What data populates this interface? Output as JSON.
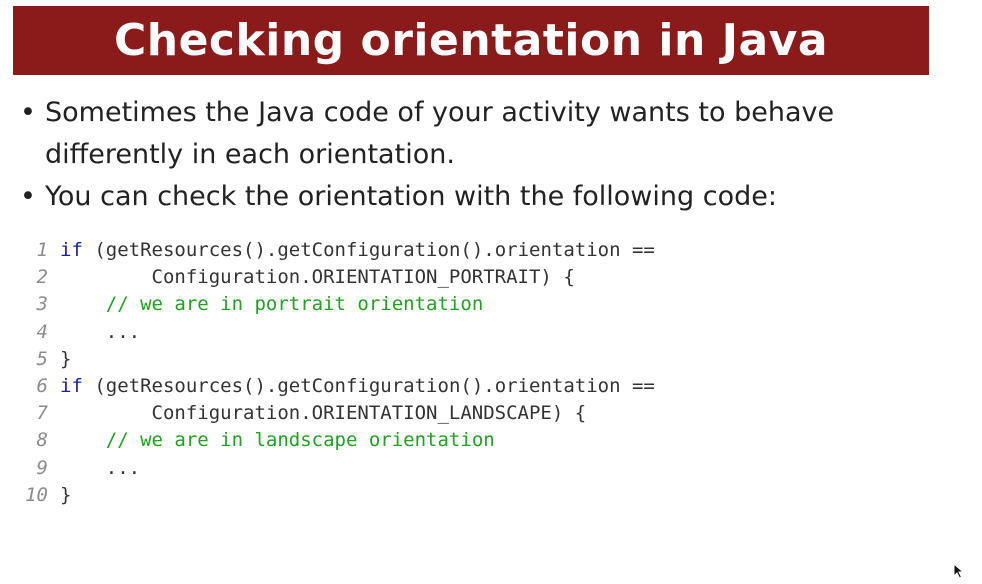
{
  "slide": {
    "title": "Checking orientation in Java",
    "bullets": [
      {
        "lines": [
          "Sometimes the Java code of your activity wants to behave",
          "differently in each orientation."
        ]
      },
      {
        "lines": [
          "You can check the orientation with the following code:"
        ]
      }
    ],
    "bullet_glyph": "•"
  },
  "code": {
    "lines": [
      {
        "num": "1",
        "keyword": "if",
        "rest": " (getResources().getConfiguration().orientation ==",
        "comment": ""
      },
      {
        "num": "2",
        "keyword": "",
        "rest": "        Configuration.ORIENTATION_PORTRAIT) {",
        "comment": ""
      },
      {
        "num": "3",
        "keyword": "",
        "rest": "    ",
        "comment": "// we are in portrait orientation"
      },
      {
        "num": "4",
        "keyword": "",
        "rest": "    ...",
        "comment": ""
      },
      {
        "num": "5",
        "keyword": "",
        "rest": "}",
        "comment": ""
      },
      {
        "num": "6",
        "keyword": "if",
        "rest": " (getResources().getConfiguration().orientation ==",
        "comment": ""
      },
      {
        "num": "7",
        "keyword": "",
        "rest": "        Configuration.ORIENTATION_LANDSCAPE) {",
        "comment": ""
      },
      {
        "num": "8",
        "keyword": "",
        "rest": "    ",
        "comment": "// we are in landscape orientation"
      },
      {
        "num": "9",
        "keyword": "",
        "rest": "    ...",
        "comment": ""
      },
      {
        "num": "10",
        "keyword": "",
        "rest": "}",
        "comment": ""
      }
    ]
  },
  "colors": {
    "title_bar": "#8b1a1a",
    "keyword": "#1a1aa6",
    "comment": "#22a022",
    "line_number": "#8c8c8c"
  },
  "icons": {
    "cursor": "mouse-pointer-icon"
  }
}
